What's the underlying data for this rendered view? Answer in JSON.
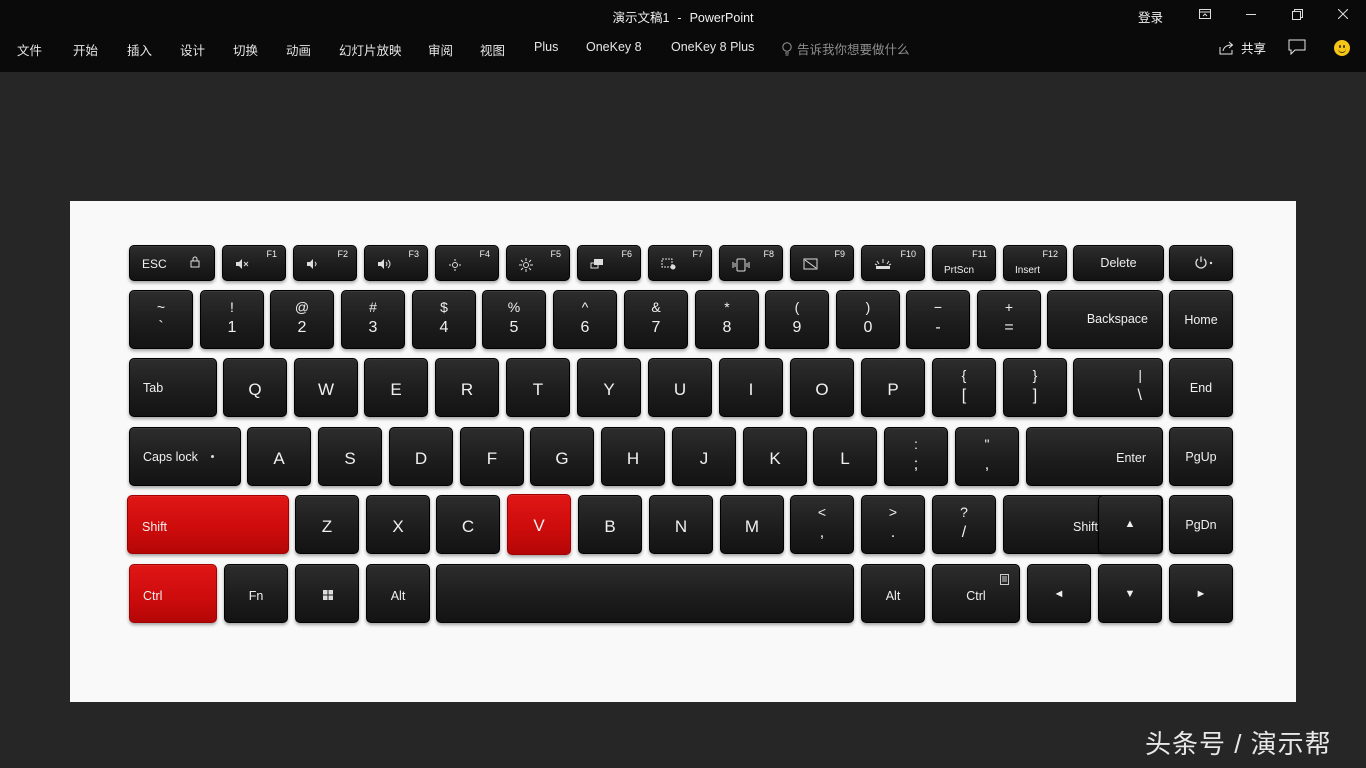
{
  "window": {
    "doc_title": "演示文稿1",
    "app_name": "PowerPoint",
    "separator": "-",
    "login": "登录"
  },
  "ribbon_tabs": [
    "文件",
    "开始",
    "插入",
    "设计",
    "切换",
    "动画",
    "幻灯片放映",
    "审阅",
    "视图",
    "Plus",
    "OneKey 8",
    "OneKey 8 Plus"
  ],
  "tell_me": "告诉我你想要做什么",
  "share": "共享",
  "keyboard": {
    "esc": "ESC",
    "f_keys": [
      "F1",
      "F2",
      "F3",
      "F4",
      "F5",
      "F6",
      "F7",
      "F8",
      "F9",
      "F10",
      "F11",
      "F12"
    ],
    "prtscn": "PrtScn",
    "insert": "Insert",
    "delete": "Delete",
    "number_row": [
      {
        "top": "~",
        "bottom": "`"
      },
      {
        "top": "!",
        "bottom": "1"
      },
      {
        "top": "@",
        "bottom": "2"
      },
      {
        "top": "#",
        "bottom": "3"
      },
      {
        "top": "$",
        "bottom": "4"
      },
      {
        "top": "%",
        "bottom": "5"
      },
      {
        "top": "^",
        "bottom": "6"
      },
      {
        "top": "&",
        "bottom": "7"
      },
      {
        "top": "*",
        "bottom": "8"
      },
      {
        "top": "(",
        "bottom": "9"
      },
      {
        "top": ")",
        "bottom": "0"
      },
      {
        "top": "−",
        "bottom": "-"
      },
      {
        "top": "+",
        "bottom": "="
      }
    ],
    "backspace": "Backspace",
    "home": "Home",
    "tab": "Tab",
    "qwerty_row": [
      "Q",
      "W",
      "E",
      "R",
      "T",
      "Y",
      "U",
      "I",
      "O",
      "P"
    ],
    "bracket_left": {
      "top": "{",
      "bottom": "["
    },
    "bracket_right": {
      "top": "}",
      "bottom": "]"
    },
    "pipe": {
      "top": "|",
      "bottom": "\\"
    },
    "end": "End",
    "caps_lock": "Caps lock",
    "asdf_row": [
      "A",
      "S",
      "D",
      "F",
      "G",
      "H",
      "J",
      "K",
      "L"
    ],
    "semicolon": {
      "top": ":",
      "bottom": ";"
    },
    "quote": {
      "top": "\"",
      "bottom": ","
    },
    "enter": "Enter",
    "pgup": "PgUp",
    "shift_left": "Shift",
    "zxcv_row": [
      "Z",
      "X",
      "C",
      "V",
      "B",
      "N",
      "M"
    ],
    "comma": {
      "top": "<",
      "bottom": ","
    },
    "period": {
      "top": ">",
      "bottom": "."
    },
    "slash": {
      "top": "?",
      "bottom": "/"
    },
    "shift_right": "Shift",
    "arrow_up": "▲",
    "pgdn": "PgDn",
    "ctrl_left": "Ctrl",
    "fn": "Fn",
    "alt_left": "Alt",
    "alt_right": "Alt",
    "ctrl_right": "Ctrl",
    "arrow_left": "◄",
    "arrow_down": "▼",
    "arrow_right": "►",
    "highlighted_keys": [
      "Ctrl",
      "Shift",
      "V"
    ],
    "highlight_color": "#d40d0d"
  },
  "watermark": "头条号 / 演示帮"
}
